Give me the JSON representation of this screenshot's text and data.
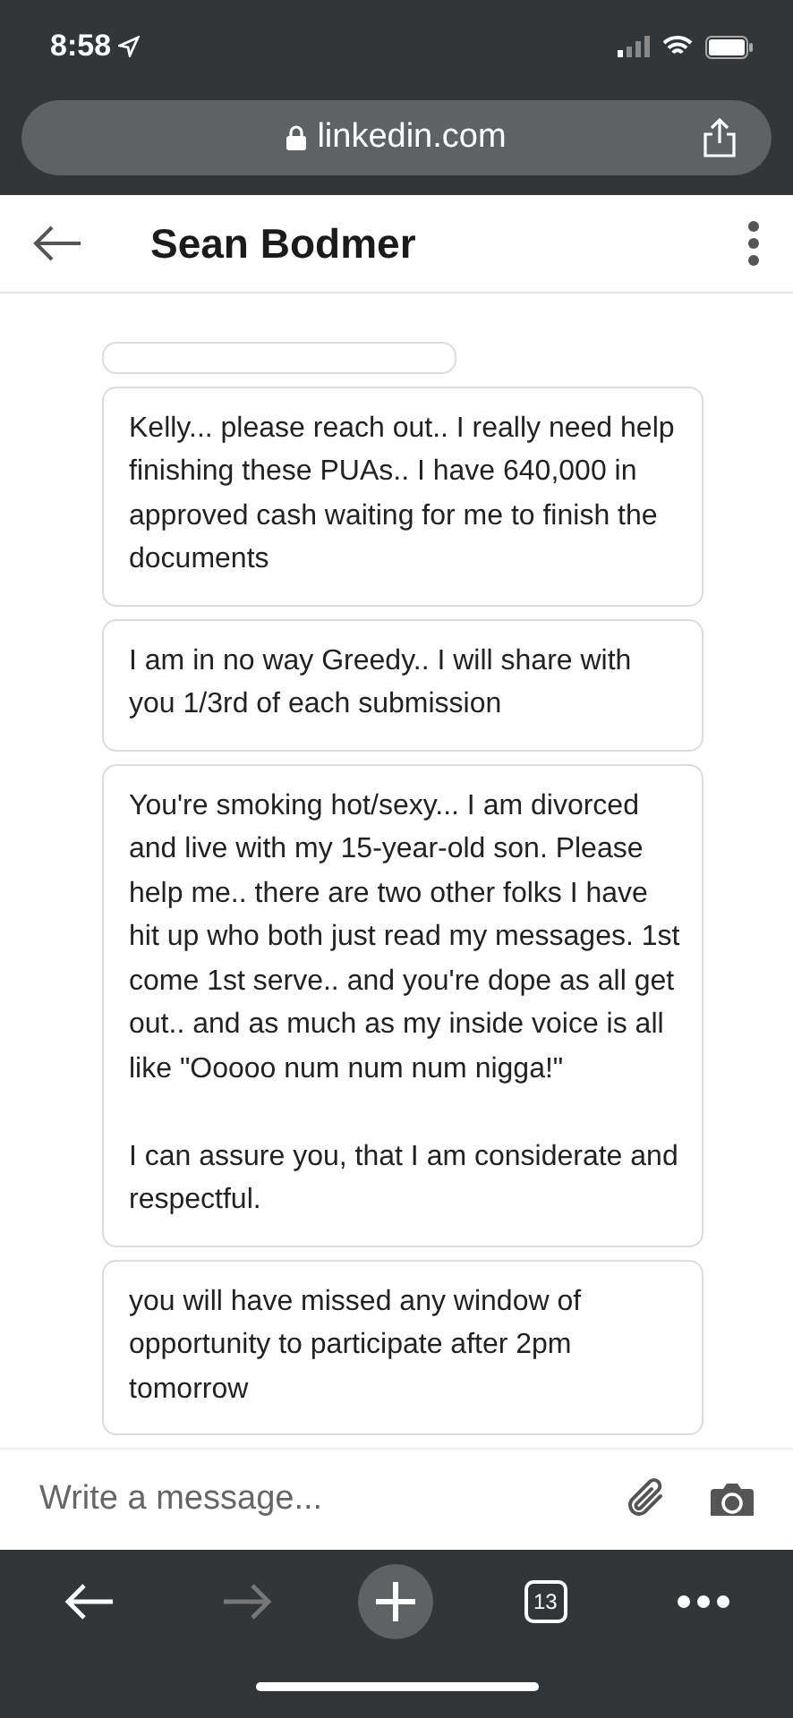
{
  "status_bar": {
    "time": "8:58"
  },
  "url_bar": {
    "domain": "linkedin.com"
  },
  "header": {
    "title": "Sean Bodmer"
  },
  "messages": [
    {
      "kind": "cut-off"
    },
    {
      "text": "Kelly... please reach out.. I really need help finishing these PUAs.. I have 640,000 in approved cash waiting for me to finish the documents"
    },
    {
      "text": "I am in no way Greedy.. I will share with you 1/3rd of each submission"
    },
    {
      "text": "You're smoking hot/sexy... I am divorced and live with my 15-year-old son. Please help me.. there are two other folks I have hit up who both just read my messages. 1st come 1st serve.. and you're dope as all get out.. and as much as my inside voice is all like \"Ooooo num num num nigga!\"\n\nI can assure you, that I am considerate and respectful."
    },
    {
      "text": "you will have missed any window of opportunity to participate after 2pm tomorrow"
    }
  ],
  "composer": {
    "placeholder": "Write a message..."
  },
  "toolbar": [
    {
      "kind": "back",
      "disabled": false
    },
    {
      "kind": "forward",
      "disabled": true
    },
    {
      "kind": "new-tab",
      "disabled": false
    },
    {
      "kind": "tabs",
      "label": "13",
      "disabled": false
    },
    {
      "kind": "more",
      "disabled": false
    }
  ]
}
